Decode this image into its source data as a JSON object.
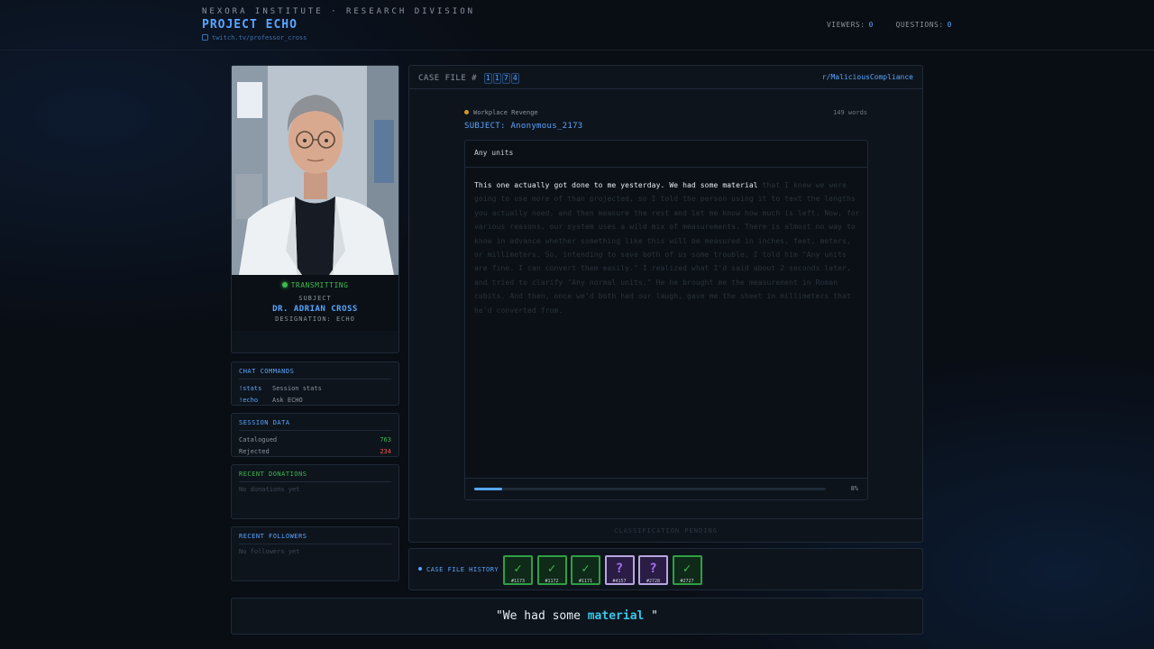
{
  "header": {
    "org": "NEXORA INSTITUTE · RESEARCH DIVISION",
    "project": "PROJECT ECHO",
    "channel": "twitch.tv/professor_cross",
    "viewers_label": "VIEWERS:",
    "viewers": "0",
    "questions_label": "QUESTIONS:",
    "questions": "0"
  },
  "profile": {
    "status": "TRANSMITTING",
    "subject_label": "SUBJECT",
    "name": "DR. ADRIAN CROSS",
    "designation": "DESIGNATION: ECHO"
  },
  "commands": {
    "title": "CHAT COMMANDS",
    "items": [
      {
        "cmd": "!stats",
        "desc": "Session stats"
      },
      {
        "cmd": "!echo",
        "desc": "Ask ECHO"
      }
    ]
  },
  "session": {
    "title": "SESSION DATA",
    "catalogued_label": "Catalogued",
    "catalogued": "763",
    "rejected_label": "Rejected",
    "rejected": "234"
  },
  "donations": {
    "title": "RECENT DONATIONS",
    "empty": "No donations yet"
  },
  "followers": {
    "title": "RECENT FOLLOWERS",
    "empty": "No followers yet"
  },
  "case": {
    "label": "CASE FILE #",
    "digits": [
      "1",
      "1",
      "7",
      "4"
    ],
    "subreddit": "r/MaliciousCompliance",
    "category": "Workplace Revenge",
    "words": "149 words",
    "subject": "SUBJECT: Anonymous_2173",
    "story_title": "Any units",
    "story_lit": "This one actually got done to me yesterday. We had some material",
    "story_dim": " that I knew we were going to use more of than projected, so I told the person using it to text the lengths you actually need, and then measure the rest and let me know how much is left. Now, for various reasons, our system uses a wild mix of measurements. There is almost no way to know in advance whether something like this will be measured in inches, feet, meters, or millimeters. So, intending to save both of us some trouble, I told him \"Any units are fine. I can convert them easily.\" I realized what I'd said about 2 seconds later, and tried to clarify \"Any normal units.\" He he brought me the measurement in Roman cubits. And then, once we'd both had our laugh, gave me the sheet in millimeters that he'd converted from.",
    "progress": 8,
    "progress_label": "8%",
    "classification": "CLASSIFICATION PENDING"
  },
  "history": {
    "label": "CASE FILE HISTORY",
    "tiles": [
      {
        "status": "ok",
        "symbol": "✓",
        "id": "#1173"
      },
      {
        "status": "ok",
        "symbol": "✓",
        "id": "#1172"
      },
      {
        "status": "ok",
        "symbol": "✓",
        "id": "#1171"
      },
      {
        "status": "q",
        "symbol": "?",
        "id": "#4157"
      },
      {
        "status": "q",
        "symbol": "?",
        "id": "#2728"
      },
      {
        "status": "ok",
        "symbol": "✓",
        "id": "#2727"
      }
    ]
  },
  "quote": {
    "before": "\"We had some ",
    "highlight": "material",
    "after": " \""
  },
  "colors": {
    "accent": "#58a6ff",
    "positive": "#3fb950",
    "negative": "#f85149",
    "category": "#d29922",
    "pending": "#a371f7",
    "highlight": "#39c5e8"
  }
}
